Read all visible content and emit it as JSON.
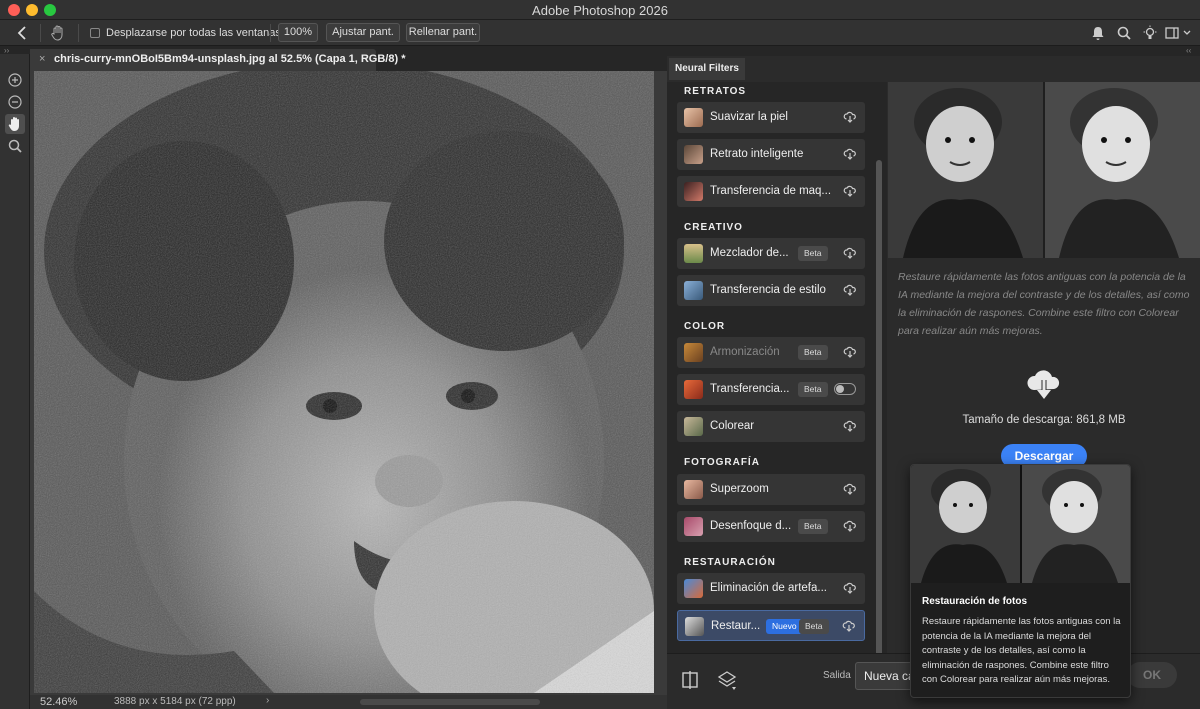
{
  "window": {
    "title": "Adobe Photoshop 2026"
  },
  "options_bar": {
    "scroll_all_label": "Desplazarse por todas las ventanas",
    "zoom_100": "100%",
    "fit_screen": "Ajustar pant.",
    "fill_screen": "Rellenar pant."
  },
  "document": {
    "tab_title": "chris-curry-mnOBoI5Bm94-unsplash.jpg al 52.5% (Capa 1, RGB/8) *",
    "zoom": "52.46%",
    "dimensions": "3888 px x 5184 px (72 ppp)",
    "status_arrow": "›"
  },
  "neural_filters": {
    "tab_label": "Neural Filters",
    "categories": [
      {
        "name": "RETRATOS",
        "items": [
          {
            "label": "Suavizar la piel"
          },
          {
            "label": "Retrato inteligente"
          },
          {
            "label": "Transferencia de maq..."
          }
        ]
      },
      {
        "name": "CREATIVO",
        "items": [
          {
            "label": "Mezclador de...",
            "badge": "Beta"
          },
          {
            "label": "Transferencia de estilo"
          }
        ]
      },
      {
        "name": "COLOR",
        "items": [
          {
            "label": "Armonización",
            "badge": "Beta"
          },
          {
            "label": "Transferencia...",
            "badge": "Beta"
          },
          {
            "label": "Colorear"
          }
        ]
      },
      {
        "name": "FOTOGRAFÍA",
        "items": [
          {
            "label": "Superzoom"
          },
          {
            "label": "Desenfoque d...",
            "badge": "Beta"
          }
        ]
      },
      {
        "name": "RESTAURACIÓN",
        "items": [
          {
            "label": "Eliminación de artefa..."
          },
          {
            "label": "Restaur...",
            "badge_new": "Nuevo",
            "badge": "Beta"
          }
        ]
      }
    ],
    "description": "Restaure rápidamente las fotos antiguas con la potencia de la IA mediante la mejora del contraste y de los detalles, así como la eliminación de raspones. Combine este filtro con Colorear para realizar aún más mejoras.",
    "download_size": "Tamaño de descarga: 861,8 MB",
    "download_button": "Descargar",
    "output_label": "Salida",
    "output_value": "Nueva capa",
    "ok_button": "OK"
  },
  "tooltip": {
    "title": "Restauración de fotos",
    "text": "Restaure rápidamente las fotos antiguas con la potencia de la IA mediante la mejora del contraste y de los detalles, así como la eliminación de raspones. Combine este filtro con Colorear para realizar aún más mejoras."
  },
  "colors": {
    "accent": "#3b82f6",
    "new_badge": "#2d6fe0",
    "panel_bg": "#2b2b2b"
  }
}
